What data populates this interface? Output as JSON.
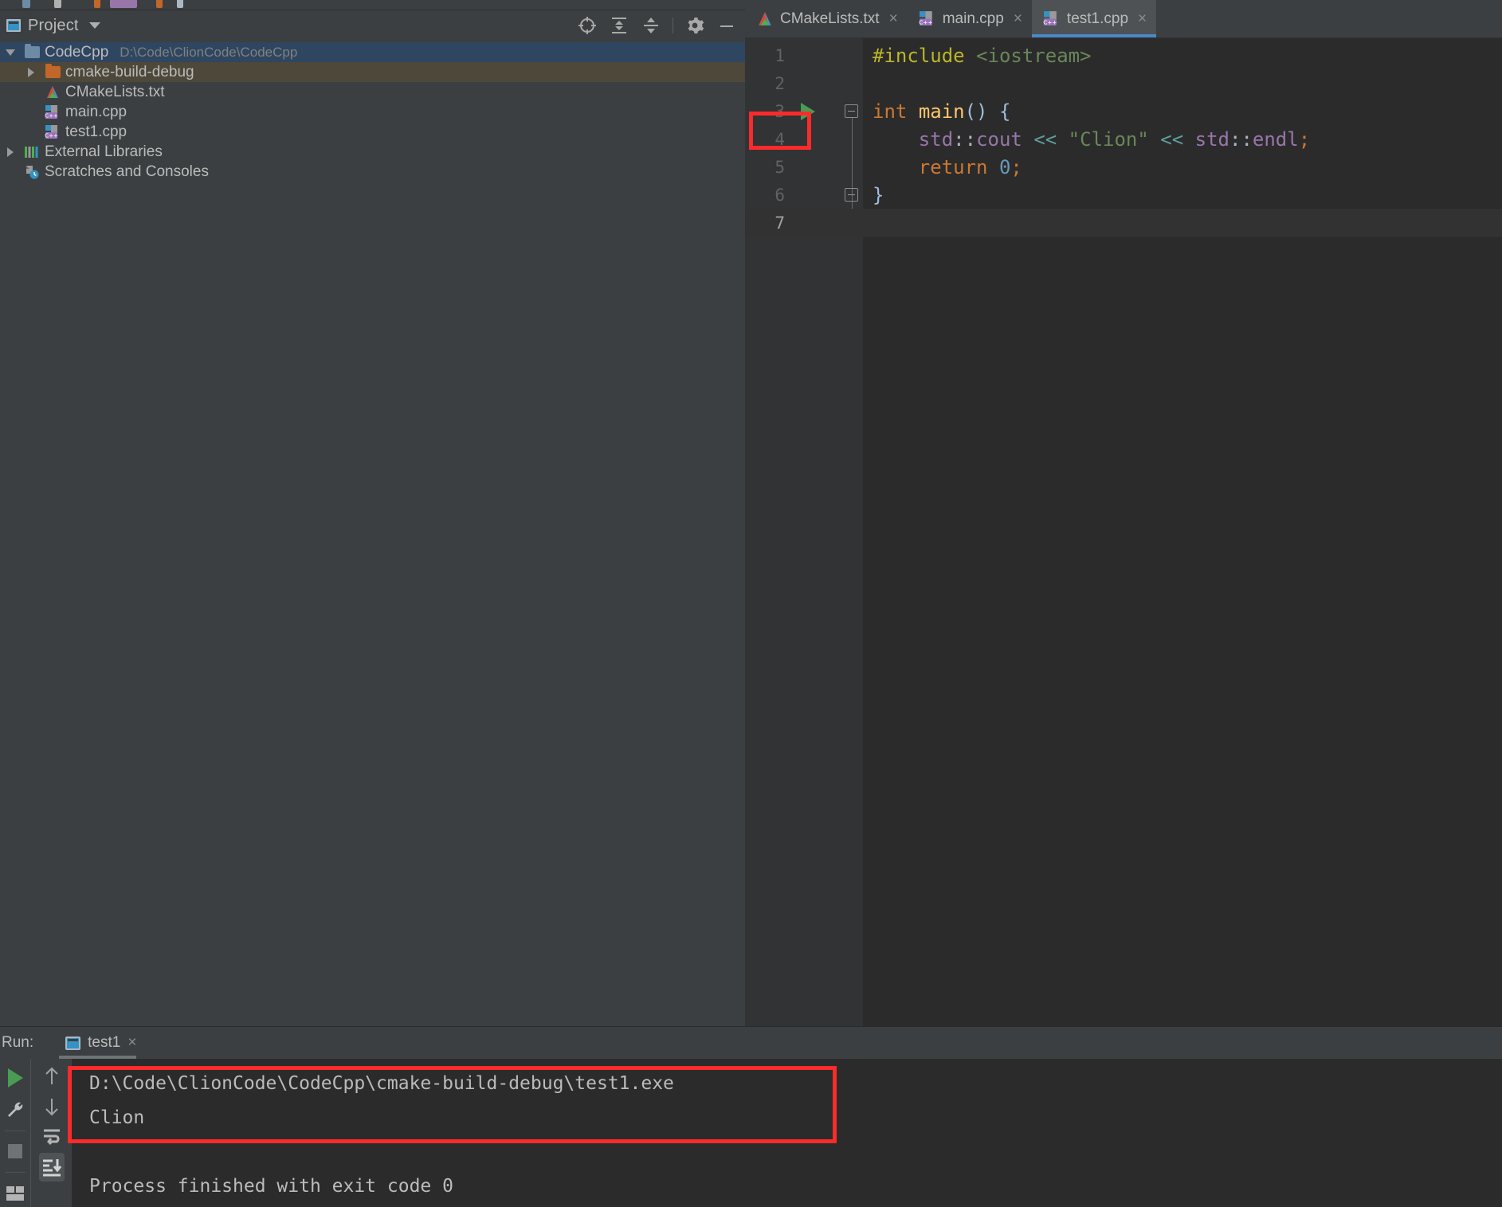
{
  "project_panel": {
    "title": "Project",
    "title_icon": "project-window-icon",
    "dropdown_icon": "chevron-down-icon",
    "toolbar": [
      {
        "name": "locate-icon",
        "label": "Select Opened File"
      },
      {
        "name": "expand-all-icon",
        "label": "Expand All"
      },
      {
        "name": "collapse-all-icon",
        "label": "Collapse All"
      },
      {
        "name": "gear-icon",
        "label": "Settings"
      },
      {
        "name": "minimize-icon",
        "label": "Hide"
      }
    ],
    "tree": [
      {
        "label": "CodeCpp",
        "path": "D:\\Code\\ClionCode\\CodeCpp",
        "icon": "folder-blue-icon",
        "arrow": "down",
        "indent": 0,
        "state": "selected"
      },
      {
        "label": "cmake-build-debug",
        "path": "",
        "icon": "folder-orange-icon",
        "arrow": "right",
        "indent": 1,
        "state": "hovered"
      },
      {
        "label": "CMakeLists.txt",
        "path": "",
        "icon": "cmake-file-icon",
        "arrow": "none",
        "indent": 1,
        "state": "normal"
      },
      {
        "label": "main.cpp",
        "path": "",
        "icon": "cpp-file-icon",
        "arrow": "none",
        "indent": 1,
        "state": "normal"
      },
      {
        "label": "test1.cpp",
        "path": "",
        "icon": "cpp-file-icon",
        "arrow": "none",
        "indent": 1,
        "state": "normal"
      },
      {
        "label": "External Libraries",
        "path": "",
        "icon": "libraries-icon",
        "arrow": "right",
        "indent": 0,
        "state": "normal"
      },
      {
        "label": "Scratches and Consoles",
        "path": "",
        "icon": "scratches-icon",
        "arrow": "none",
        "indent": 0,
        "state": "normal"
      }
    ]
  },
  "editor": {
    "tabs": [
      {
        "label": "CMakeLists.txt",
        "icon": "cmake-file-icon",
        "active": false,
        "close": "×"
      },
      {
        "label": "main.cpp",
        "icon": "cpp-file-icon",
        "active": false,
        "close": "×"
      },
      {
        "label": "test1.cpp",
        "icon": "cpp-file-icon",
        "active": true,
        "close": "×"
      }
    ],
    "line_numbers": [
      "1",
      "2",
      "3",
      "4",
      "5",
      "6",
      "7"
    ],
    "current_line": 7,
    "run_marker_line": 3,
    "code": [
      {
        "n": "1",
        "text": "#include <iostream>"
      },
      {
        "n": "2",
        "text": ""
      },
      {
        "n": "3",
        "text": "int main() {"
      },
      {
        "n": "4",
        "text": "    std::cout << \"Clion\" << std::endl;"
      },
      {
        "n": "5",
        "text": "    return 0;"
      },
      {
        "n": "6",
        "text": "}"
      },
      {
        "n": "7",
        "text": ""
      }
    ]
  },
  "run_panel": {
    "label": "Run:",
    "tab_label": "test1",
    "tab_close": "×",
    "tab_icon": "run-config-icon",
    "left_tools": [
      {
        "name": "rerun-icon"
      },
      {
        "name": "wrench-icon"
      },
      {
        "name": "stop-icon"
      },
      {
        "name": "layout-icon"
      }
    ],
    "right_tools": [
      {
        "name": "arrow-up-icon"
      },
      {
        "name": "arrow-down-icon"
      },
      {
        "name": "soft-wrap-icon"
      },
      {
        "name": "scroll-to-end-icon"
      }
    ],
    "console_lines": [
      "D:\\Code\\ClionCode\\CodeCpp\\cmake-build-debug\\test1.exe",
      "Clion",
      "",
      "Process finished with exit code 0"
    ]
  },
  "annotations": [
    {
      "name": "gutter-run-marker-highlight",
      "color": "#fb2b2b"
    },
    {
      "name": "console-output-highlight",
      "color": "#fb2b2b"
    }
  ],
  "colors": {
    "accent_tab": "#4a88c7",
    "selection": "#2f4661",
    "hover": "#4e483a",
    "annotation_red": "#fb2b2b",
    "run_green": "#499c54",
    "panel_bg": "#3c3f41",
    "editor_bg": "#2b2b2b"
  }
}
